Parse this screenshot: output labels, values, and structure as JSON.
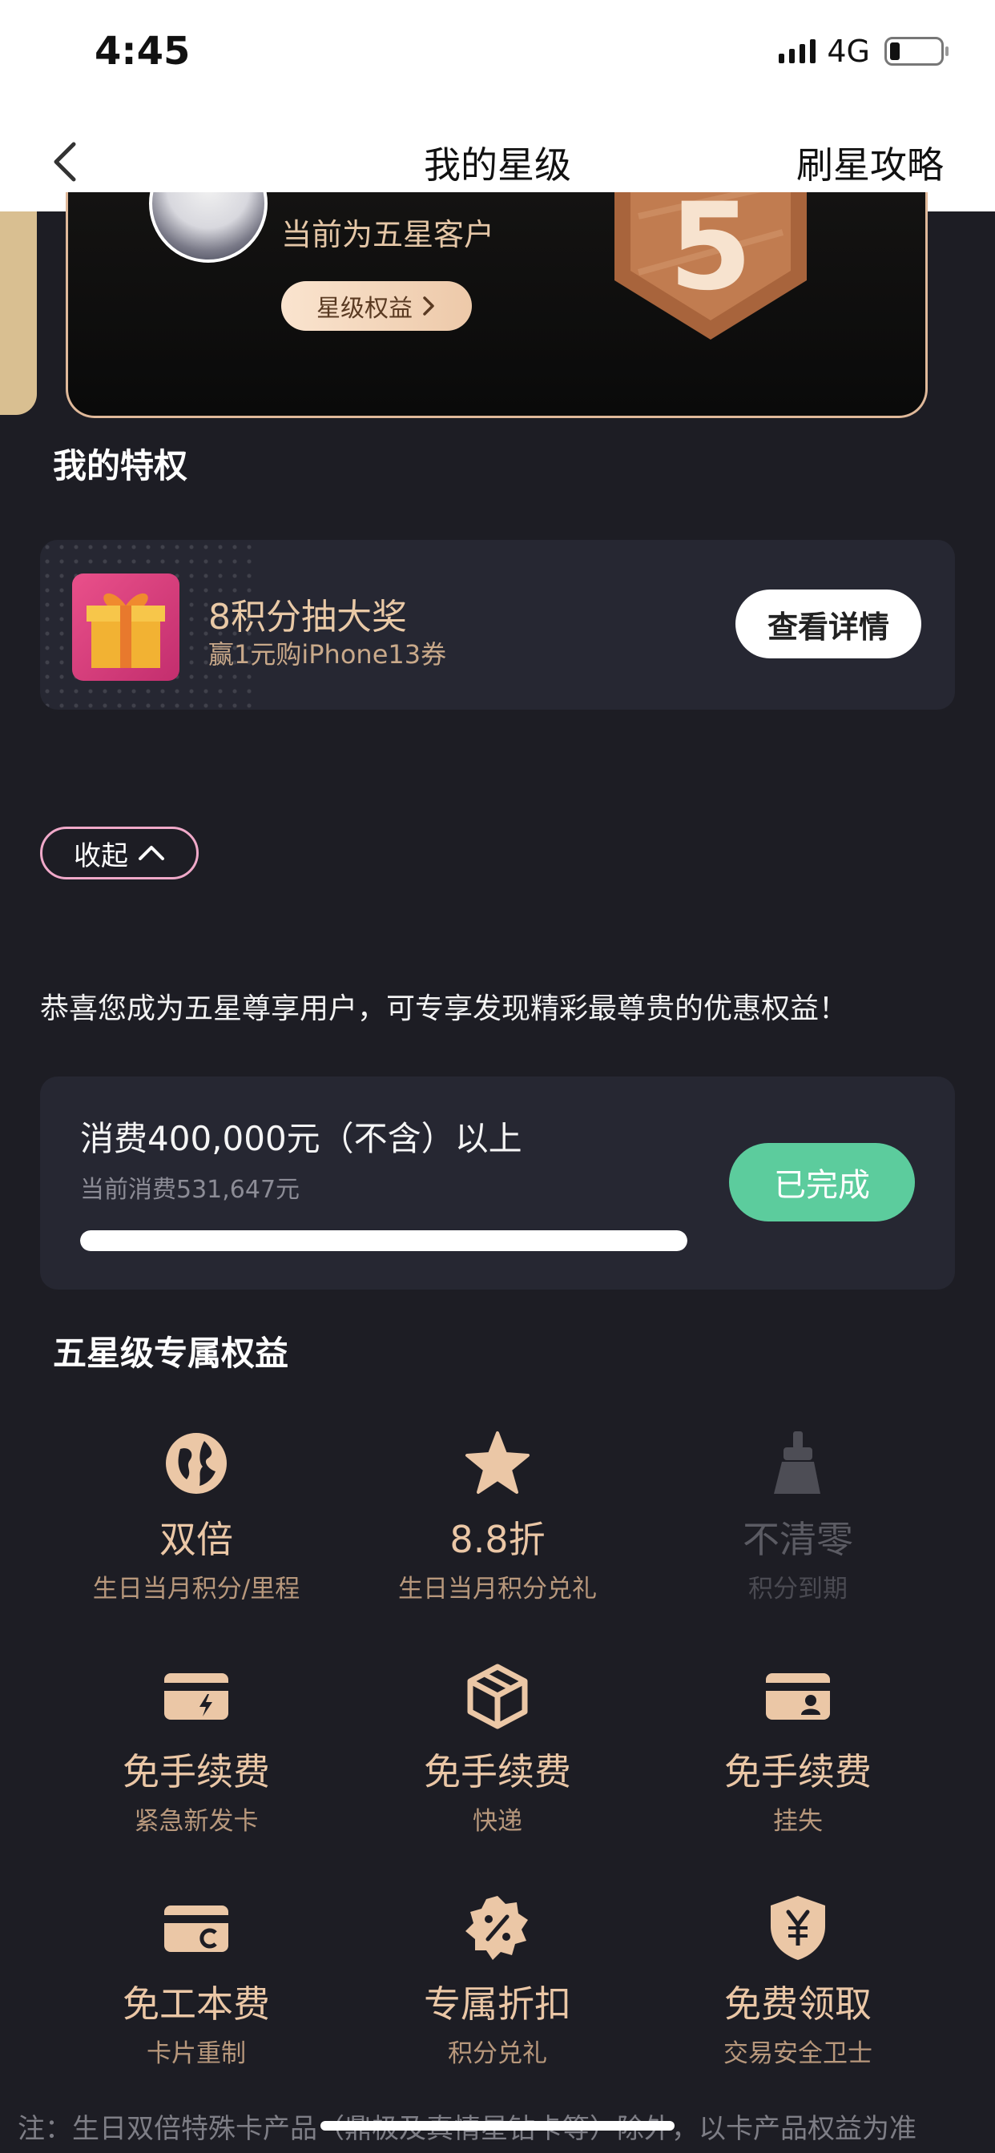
{
  "status_bar": {
    "time": "4:45",
    "network": "4G",
    "battery_level": 0.2
  },
  "nav": {
    "title": "我的星级",
    "right_action": "刷星攻略"
  },
  "star_card": {
    "level_text": "当前为五星客户",
    "benefit_button": "星级权益",
    "badge_number": "5"
  },
  "privileges": {
    "title": "我的特权",
    "promo": {
      "title": "8积分抽大奖",
      "subtitle": "赢1元购iPhone13券",
      "button": "查看详情"
    }
  },
  "collapse_button": "收起",
  "congrats_text": "恭喜您成为五星尊享用户，可专享发现精彩最尊贵的优惠权益！",
  "requirement": {
    "text": "消费400,000元（不含）以上",
    "current": "当前消费531,647元",
    "progress": 1.0,
    "status_button": "已完成"
  },
  "exclusive": {
    "title": "五星级专属权益",
    "items": [
      {
        "icon": "globe-icon",
        "title": "双倍",
        "subtitle": "生日当月积分/里程",
        "enabled": true
      },
      {
        "icon": "star-icon",
        "title": "8.8折",
        "subtitle": "生日当月积分兑礼",
        "enabled": true
      },
      {
        "icon": "broom-icon",
        "title": "不清零",
        "subtitle": "积分到期",
        "enabled": false
      },
      {
        "icon": "card-flash-icon",
        "title": "免手续费",
        "subtitle": "紧急新发卡",
        "enabled": true
      },
      {
        "icon": "package-icon",
        "title": "免手续费",
        "subtitle": "快递",
        "enabled": true
      },
      {
        "icon": "card-person-icon",
        "title": "免手续费",
        "subtitle": "挂失",
        "enabled": true
      },
      {
        "icon": "card-refresh-icon",
        "title": "免工本费",
        "subtitle": "卡片重制",
        "enabled": true
      },
      {
        "icon": "discount-icon",
        "title": "专属折扣",
        "subtitle": "积分兑礼",
        "enabled": true
      },
      {
        "icon": "shield-yen-icon",
        "title": "免费领取",
        "subtitle": "交易安全卫士",
        "enabled": true
      }
    ]
  },
  "footnote": "注：生日双倍特殊卡产品（鼎极及真情星钻卡等）除外，以卡产品权益为准",
  "colors": {
    "accent_gold": "#ebc7a6",
    "success_green": "#5ccc9d",
    "background": "#1d1d24",
    "card": "#262732"
  }
}
